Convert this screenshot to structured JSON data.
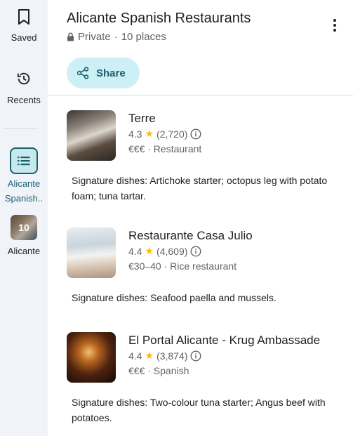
{
  "rail": {
    "saved_label": "Saved",
    "recents_label": "Recents",
    "active_list_label_line1": "Alicante",
    "active_list_label_line2": "Spanish..",
    "alicante_count": "10",
    "alicante_label": "Alicante"
  },
  "header": {
    "title": "Alicante Spanish Restaurants",
    "privacy": "Private",
    "separator": "·",
    "place_count": "10 places",
    "share_label": "Share"
  },
  "places": [
    {
      "name": "Terre",
      "rating": "4.3",
      "reviews": "(2,720)",
      "meta": "€€€ · Restaurant",
      "note": "Signature dishes: Artichoke starter; octopus leg with potato foam; tuna tartar."
    },
    {
      "name": "Restaurante Casa Julio",
      "rating": "4.4",
      "reviews": "(4,609)",
      "meta": "€30–40 · Rice restaurant",
      "note": "Signature dishes: Seafood paella and mussels."
    },
    {
      "name": "El Portal Alicante - Krug Ambassade",
      "rating": "4.4",
      "reviews": "(3,874)",
      "meta": "€€€ · Spanish",
      "note": "Signature dishes: Two-colour tuna starter; Angus beef with potatoes."
    }
  ],
  "icons": {
    "saved": "bookmark-icon",
    "recents": "history-icon",
    "list": "list-icon",
    "lock": "lock-icon",
    "share": "share-icon",
    "menu": "more-vert-icon",
    "star": "star-icon",
    "info": "info-icon"
  },
  "colors": {
    "accent": "#1a5f6b",
    "share_bg": "#cdf0f7",
    "rail_bg": "#f0f4f9",
    "star": "#fbbc04"
  }
}
